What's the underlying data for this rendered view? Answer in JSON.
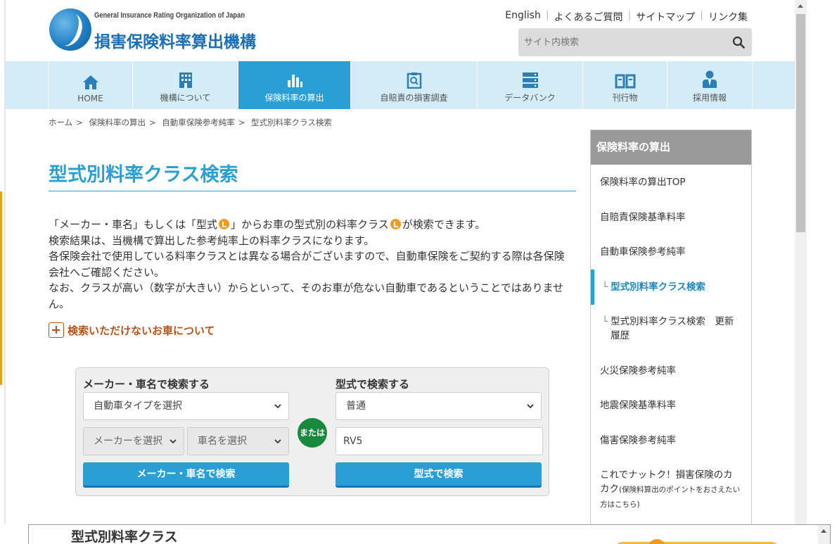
{
  "header": {
    "org_en": "General Insurance Rating Organization of Japan",
    "org_jp": "損害保険料率算出機構",
    "util_links": [
      "English",
      "よくあるご質問",
      "サイトマップ",
      "リンク集"
    ],
    "search_placeholder": "サイト内検索"
  },
  "nav": {
    "items": [
      {
        "label": "HOME",
        "icon": "home-icon"
      },
      {
        "label": "機構について",
        "icon": "building-icon"
      },
      {
        "label": "保険料率の算出",
        "icon": "bar-chart-icon",
        "active": true
      },
      {
        "label": "自賠責の損害調査",
        "icon": "clipboard-search-icon"
      },
      {
        "label": "データバンク",
        "icon": "server-icon"
      },
      {
        "label": "刊行物",
        "icon": "book-icon"
      },
      {
        "label": "採用情報",
        "icon": "person-icon"
      }
    ]
  },
  "breadcrumb": [
    "ホーム",
    "保険料率の算出",
    "自動車保険参考純率",
    "型式別料率クラス検索"
  ],
  "main": {
    "title": "型式別料率クラス検索",
    "intro_line1_a": "「メーカー・車名」もしくは「",
    "intro_line1_b": "型式",
    "intro_line1_c": "」からお車の",
    "intro_line1_d": "型式別の料率クラス",
    "intro_line1_e": "が検索できます。",
    "intro_line2": "検索結果は、当機構で算出した参考純率上の料率クラスになります。",
    "intro_line3": "各保険会社で使用している料率クラスとは異なる場合がございますので、自動車保険をご契約する際は各保険会社へご確認ください。",
    "intro_line4": "なお、クラスが高い（数字が大きい）からといって、そのお車が危ない自動車であるということではありません。",
    "expand_link": "検索いただけないお車について"
  },
  "search_panel": {
    "maker_heading": "メーカー・車名で検索する",
    "car_type_select": "自動車タイプを選択",
    "maker_select": "メーカーを選択",
    "car_name_select": "車名を選択",
    "maker_button": "メーカー・車名で検索",
    "or_label": "または",
    "model_heading": "型式で検索する",
    "model_type_select": "普通",
    "model_input_value": "RV5",
    "model_button": "型式で検索"
  },
  "sidebar": {
    "heading": "保険料率の算出",
    "items": [
      {
        "label": "保険料率の算出TOP"
      },
      {
        "label": "自賠責保険基準料率"
      },
      {
        "label": "自動車保険参考純率"
      },
      {
        "label": "型式別料率クラス検索",
        "sub": true,
        "current": true
      },
      {
        "label": "型式別料率クラス検索　更新履歴",
        "sub": true
      },
      {
        "label": "火災保険参考純率"
      },
      {
        "label": "地震保険基準料率"
      },
      {
        "label": "傷害保険参考純率"
      },
      {
        "label": "これでナットク！損害保険のカカク",
        "note": "(保険料算出のポイントをおさえたい方はこちら)"
      }
    ]
  },
  "popup": {
    "title": "型式別料率クラス"
  },
  "colors": {
    "accent": "#2a9fd6",
    "nav_bg": "#d3ecf6",
    "or_badge": "#178a3d",
    "link_orange": "#b5541a"
  }
}
